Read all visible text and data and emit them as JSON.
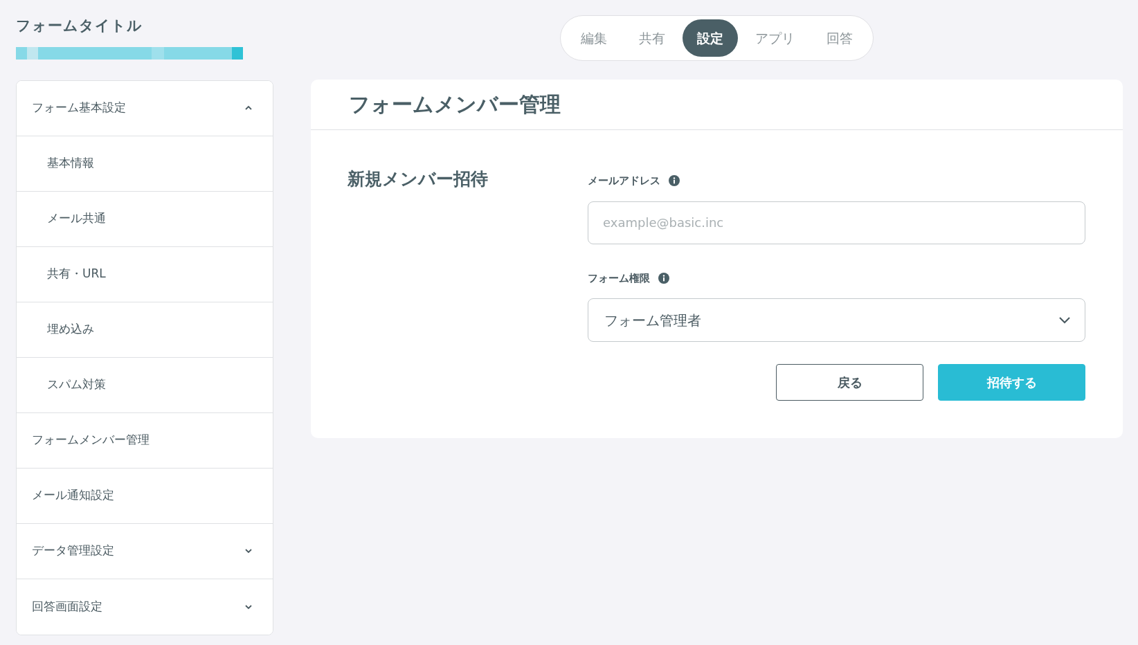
{
  "form_title": "フォームタイトル",
  "tabs": [
    {
      "label": "編集",
      "selected": false
    },
    {
      "label": "共有",
      "selected": false
    },
    {
      "label": "設定",
      "selected": true
    },
    {
      "label": "アプリ",
      "selected": false
    },
    {
      "label": "回答",
      "selected": false
    }
  ],
  "sidebar": {
    "items": [
      {
        "label": "フォーム基本設定",
        "expanded": true,
        "children": [
          {
            "label": "基本情報"
          },
          {
            "label": "メール共通"
          },
          {
            "label": "共有・URL"
          },
          {
            "label": "埋め込み"
          },
          {
            "label": "スパム対策"
          }
        ]
      },
      {
        "label": "フォームメンバー管理"
      },
      {
        "label": "メール通知設定"
      },
      {
        "label": "データ管理設定",
        "expanded": false
      },
      {
        "label": "回答画面設定",
        "expanded": false
      }
    ]
  },
  "panel": {
    "title": "フォームメンバー管理",
    "section_title": "新規メンバー招待",
    "email": {
      "label": "メールアドレス",
      "placeholder": "example@basic.inc"
    },
    "permission": {
      "label": "フォーム権限",
      "value": "フォーム管理者"
    },
    "buttons": [
      {
        "label": "戻る",
        "kind": "secondary"
      },
      {
        "label": "招待する",
        "kind": "primary"
      }
    ]
  }
}
